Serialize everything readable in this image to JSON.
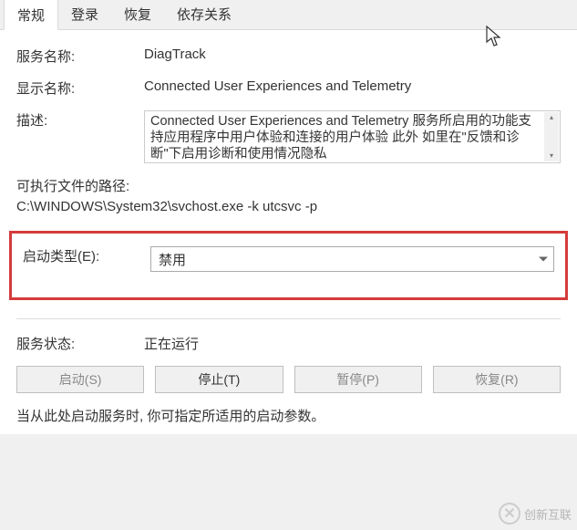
{
  "tabs": {
    "general": "常规",
    "logon": "登录",
    "recovery": "恢复",
    "dependencies": "依存关系"
  },
  "labels": {
    "service_name": "服务名称:",
    "display_name": "显示名称:",
    "description": "描述:",
    "exec_path": "可执行文件的路径:",
    "startup_type": "启动类型(E):",
    "service_status": "服务状态:",
    "hint": "当从此处启动服务时,  你可指定所适用的启动参数。"
  },
  "values": {
    "service_name": "DiagTrack",
    "display_name": "Connected User Experiences and Telemetry",
    "description": "Connected User Experiences and Telemetry 服务所启用的功能支持应用程序中用户体验和连接的用户体验      此外    如里在\"反馈和诊断\"下启用诊断和使用情况隐私",
    "exec_path": "C:\\WINDOWS\\System32\\svchost.exe -k utcsvc -p",
    "startup_type_selected": "禁用",
    "service_status": "正在运行"
  },
  "buttons": {
    "start": "启动(S)",
    "stop": "停止(T)",
    "pause": "暂停(P)",
    "resume": "恢复(R)"
  },
  "watermark": "创新互联"
}
